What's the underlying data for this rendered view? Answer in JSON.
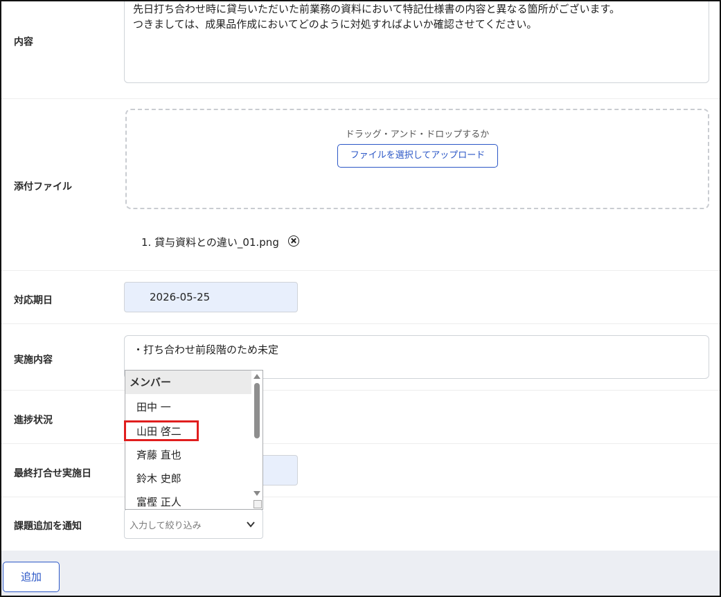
{
  "form": {
    "content": {
      "label": "内容",
      "line1": "先日打ち合わせ時に貸与いただいた前業務の資料において特記仕様書の内容と異なる箇所がございます。",
      "line2": "つきましては、成果品作成においてどのように対処すればよいか確認させてください。"
    },
    "attachment": {
      "label": "添付ファイル",
      "drop_text": "ドラッグ・アンド・ドロップするか",
      "upload_button": "ファイルを選択してアップロード",
      "files": [
        "1. 貸与資料との違い_01.png"
      ]
    },
    "due_date": {
      "label": "対応期日",
      "value": "2026-05-25"
    },
    "implementation": {
      "label": "実施内容",
      "value": "・打ち合わせ前段階のため未定"
    },
    "progress": {
      "label": "進捗状況"
    },
    "last_meeting": {
      "label": "最終打合せ実施日"
    },
    "notify": {
      "label": "課題追加を通知",
      "placeholder": "入力して絞り込み"
    }
  },
  "dropdown": {
    "group_label": "メンバー",
    "options": [
      "田中 一",
      "山田 啓二",
      "斉藤 直也",
      "鈴木 史郎",
      "富樫 正人"
    ],
    "highlighted": "山田 啓二"
  },
  "footer": {
    "add_button": "追加"
  },
  "colors": {
    "accent": "#2a56c6",
    "date_bg": "#e8effc",
    "highlight": "#e01e1e"
  }
}
